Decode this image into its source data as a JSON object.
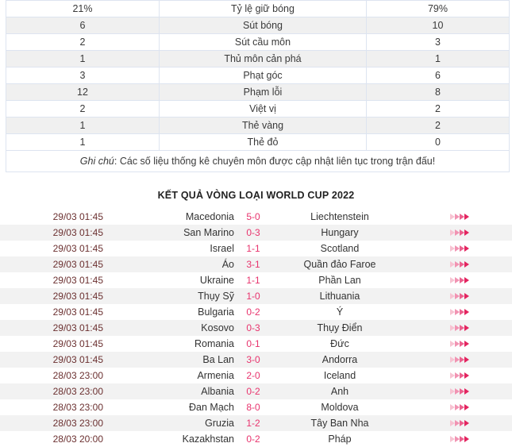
{
  "stats_table": {
    "columns": [
      "home",
      "label",
      "away"
    ],
    "rows": [
      {
        "home": "21%",
        "label": "Tỷ lệ giữ bóng",
        "away": "79%"
      },
      {
        "home": "6",
        "label": "Sút bóng",
        "away": "10"
      },
      {
        "home": "2",
        "label": "Sút cầu môn",
        "away": "3"
      },
      {
        "home": "1",
        "label": "Thủ môn cản phá",
        "away": "1"
      },
      {
        "home": "3",
        "label": "Phạt góc",
        "away": "6"
      },
      {
        "home": "12",
        "label": "Phạm lỗi",
        "away": "8"
      },
      {
        "home": "2",
        "label": "Việt vị",
        "away": "2"
      },
      {
        "home": "1",
        "label": "Thẻ vàng",
        "away": "2"
      },
      {
        "home": "1",
        "label": "Thẻ đỏ",
        "away": "0"
      }
    ],
    "note_label": "Ghi chú",
    "note_text": ": Các số liệu thống kê chuyên môn được cập nhật liên tục trong trận đấu!"
  },
  "results": {
    "title": "KẾT QUẢ VÒNG LOẠI WORLD CUP 2022",
    "arrow_icon": "double-chevron-right-icon",
    "arrow_colors": [
      "#f7c3d2",
      "#f193b2",
      "#ec5f8d",
      "#e3245f"
    ],
    "matches": [
      {
        "time": "29/03 01:45",
        "home": "Macedonia",
        "score": "5-0",
        "away": "Liechtenstein"
      },
      {
        "time": "29/03 01:45",
        "home": "San Marino",
        "score": "0-3",
        "away": "Hungary"
      },
      {
        "time": "29/03 01:45",
        "home": "Israel",
        "score": "1-1",
        "away": "Scotland"
      },
      {
        "time": "29/03 01:45",
        "home": "Áo",
        "score": "3-1",
        "away": "Quần đảo Faroe"
      },
      {
        "time": "29/03 01:45",
        "home": "Ukraine",
        "score": "1-1",
        "away": "Phần Lan"
      },
      {
        "time": "29/03 01:45",
        "home": "Thụy Sỹ",
        "score": "1-0",
        "away": "Lithuania"
      },
      {
        "time": "29/03 01:45",
        "home": "Bulgaria",
        "score": "0-2",
        "away": "Ý"
      },
      {
        "time": "29/03 01:45",
        "home": "Kosovo",
        "score": "0-3",
        "away": "Thụy Điển"
      },
      {
        "time": "29/03 01:45",
        "home": "Romania",
        "score": "0-1",
        "away": "Đức"
      },
      {
        "time": "29/03 01:45",
        "home": "Ba Lan",
        "score": "3-0",
        "away": "Andorra"
      },
      {
        "time": "28/03 23:00",
        "home": "Armenia",
        "score": "2-0",
        "away": "Iceland"
      },
      {
        "time": "28/03 23:00",
        "home": "Albania",
        "score": "0-2",
        "away": "Anh"
      },
      {
        "time": "28/03 23:00",
        "home": "Đan Mạch",
        "score": "8-0",
        "away": "Moldova"
      },
      {
        "time": "28/03 23:00",
        "home": "Gruzia",
        "score": "1-2",
        "away": "Tây Ban Nha"
      },
      {
        "time": "28/03 20:00",
        "home": "Kazakhstan",
        "score": "0-2",
        "away": "Pháp"
      }
    ]
  },
  "colors": {
    "table_border": "#dde4f0",
    "row_alt": "#f0f0f0",
    "score_accent": "#e8336d",
    "time_text": "#6b3030"
  }
}
